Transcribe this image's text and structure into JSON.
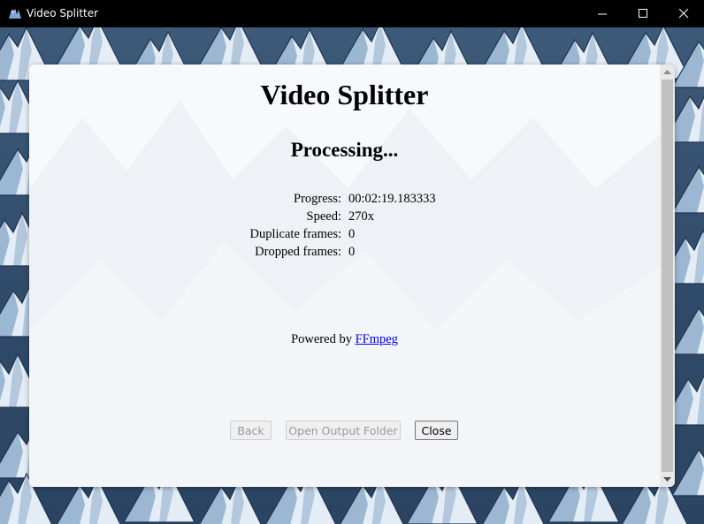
{
  "window": {
    "title": "Video Splitter"
  },
  "app": {
    "heading": "Video Splitter",
    "status": "Processing..."
  },
  "stats": [
    {
      "label": "Progress:",
      "value": "00:02:19.183333"
    },
    {
      "label": "Speed:",
      "value": "270x"
    },
    {
      "label": "Duplicate frames:",
      "value": "0"
    },
    {
      "label": "Dropped frames:",
      "value": "0"
    }
  ],
  "footer": {
    "powered_prefix": "Powered by",
    "powered_link": "FFmpeg"
  },
  "buttons": {
    "back": {
      "label": "Back",
      "enabled": false
    },
    "open_output_folder": {
      "label": "Open Output Folder",
      "enabled": false
    },
    "close": {
      "label": "Close",
      "enabled": true
    }
  },
  "icons": {
    "app": "video-splitter-app-icon",
    "minimize": "minimize-icon",
    "maximize": "maximize-icon",
    "close": "close-icon",
    "scroll_up": "scroll-up-arrow-icon",
    "scroll_down": "scroll-down-arrow-icon"
  },
  "colors": {
    "titlebar": "#000000",
    "desktop": "#3d5a78",
    "panel": "#f8f9fb",
    "link": "#0000ee"
  }
}
